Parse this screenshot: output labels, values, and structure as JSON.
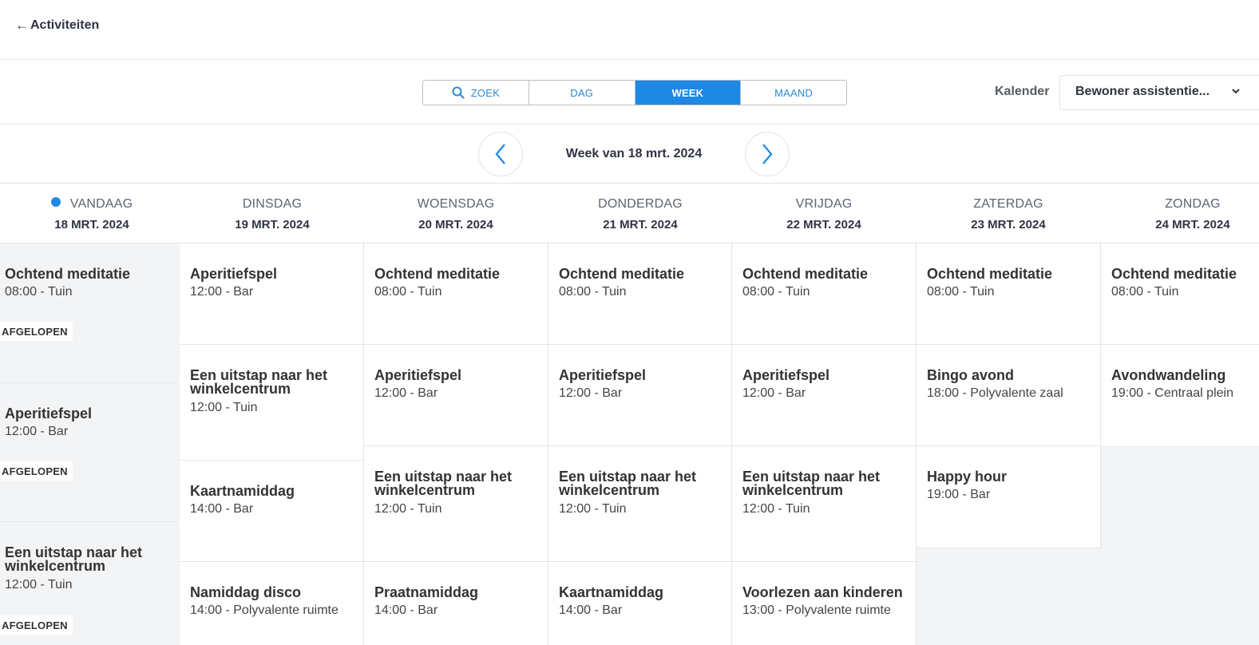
{
  "header": {
    "back_label": "Activiteiten",
    "back_arrow": "←"
  },
  "toolbar": {
    "views": [
      {
        "label": "ZOEK",
        "icon": "search-icon",
        "active": false
      },
      {
        "label": "DAG",
        "active": false
      },
      {
        "label": "WEEK",
        "active": true
      },
      {
        "label": "MAAND",
        "active": false
      }
    ],
    "calendar_label": "Kalender",
    "calendar_value": "Bewoner assistentie..."
  },
  "weeknav": {
    "label": "Week van 18 mrt. 2024"
  },
  "days": [
    {
      "name": "VANDAAG",
      "date": "18 MRT. 2024",
      "today": true
    },
    {
      "name": "DINSDAG",
      "date": "19 MRT. 2024"
    },
    {
      "name": "WOENSDAG",
      "date": "20 MRT. 2024"
    },
    {
      "name": "DONDERDAG",
      "date": "21 MRT. 2024"
    },
    {
      "name": "VRIJDAG",
      "date": "22 MRT. 2024"
    },
    {
      "name": "ZATERDAG",
      "date": "23 MRT. 2024"
    },
    {
      "name": "ZONDAG",
      "date": "24 MRT. 2024"
    }
  ],
  "events": [
    [
      {
        "title": "Ochtend meditatie",
        "info": "08:00 - Tuin",
        "status": "AFGELOPEN"
      },
      {
        "title": "Aperitiefspel",
        "info": "12:00 - Bar",
        "status": "AFGELOPEN"
      },
      {
        "title": "Een uitstap naar het winkelcentrum",
        "info": "12:00 - Tuin",
        "status": "AFGELOPEN"
      }
    ],
    [
      {
        "title": "Aperitiefspel",
        "info": "12:00 - Bar"
      },
      {
        "title": "Een uitstap naar het winkelcentrum",
        "info": "12:00 - Tuin"
      },
      {
        "title": "Kaartnamiddag",
        "info": "14:00 - Bar"
      },
      {
        "title": "Namiddag disco",
        "info": "14:00 - Polyvalente ruimte"
      }
    ],
    [
      {
        "title": "Ochtend meditatie",
        "info": "08:00 - Tuin"
      },
      {
        "title": "Aperitiefspel",
        "info": "12:00 - Bar"
      },
      {
        "title": "Een uitstap naar het winkelcentrum",
        "info": "12:00 - Tuin"
      },
      {
        "title": "Praatnamiddag",
        "info": "14:00 - Bar"
      }
    ],
    [
      {
        "title": "Ochtend meditatie",
        "info": "08:00 - Tuin"
      },
      {
        "title": "Aperitiefspel",
        "info": "12:00 - Bar"
      },
      {
        "title": "Een uitstap naar het winkelcentrum",
        "info": "12:00 - Tuin"
      },
      {
        "title": "Kaartnamiddag",
        "info": "14:00 - Bar"
      }
    ],
    [
      {
        "title": "Ochtend meditatie",
        "info": "08:00 - Tuin"
      },
      {
        "title": "Aperitiefspel",
        "info": "12:00 - Bar"
      },
      {
        "title": "Een uitstap naar het winkelcentrum",
        "info": "12:00 - Tuin"
      },
      {
        "title": "Voorlezen aan kinderen",
        "info": "13:00 - Polyvalente ruimte"
      }
    ],
    [
      {
        "title": "Ochtend meditatie",
        "info": "08:00 - Tuin"
      },
      {
        "title": "Bingo avond",
        "info": "18:00 - Polyvalente zaal"
      },
      {
        "title": "Happy hour",
        "info": "19:00 - Bar"
      }
    ],
    [
      {
        "title": "Ochtend meditatie",
        "info": "08:00 - Tuin"
      },
      {
        "title": "Avondwandeling",
        "info": "19:00 - Centraal plein"
      }
    ]
  ]
}
